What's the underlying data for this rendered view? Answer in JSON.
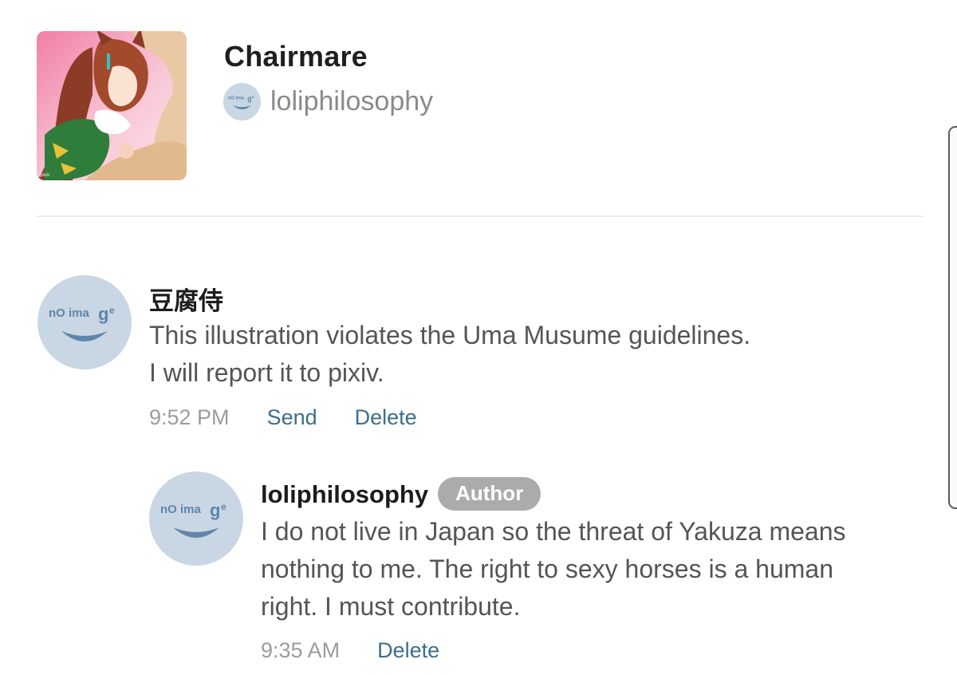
{
  "work": {
    "title": "Chairmare",
    "author": "loliphilosophy",
    "thumbnail_icon": "illustration-thumbnail",
    "author_avatar_icon": "no-image-avatar"
  },
  "avatar_placeholder": {
    "text_prefix": "nO ima",
    "text_suffix": "ge",
    "color": "#c9d6e3"
  },
  "comments": [
    {
      "user": "豆腐侍",
      "lines": [
        "This illustration violates the Uma Musume guidelines.",
        "I will report it to pixiv."
      ],
      "time": "9:52 PM",
      "send_label": "Send",
      "delete_label": "Delete"
    }
  ],
  "reply": {
    "user": "loliphilosophy",
    "badge": "Author",
    "lines": [
      "I do not live in Japan so the threat of Yakuza means",
      "nothing to me. The right to sexy horses is a human",
      "right. I must contribute."
    ],
    "time": "9:35 AM",
    "delete_label": "Delete"
  },
  "colors": {
    "link": "#3c6e8a",
    "muted": "#9c9c9c",
    "badge_bg": "#ababab"
  }
}
